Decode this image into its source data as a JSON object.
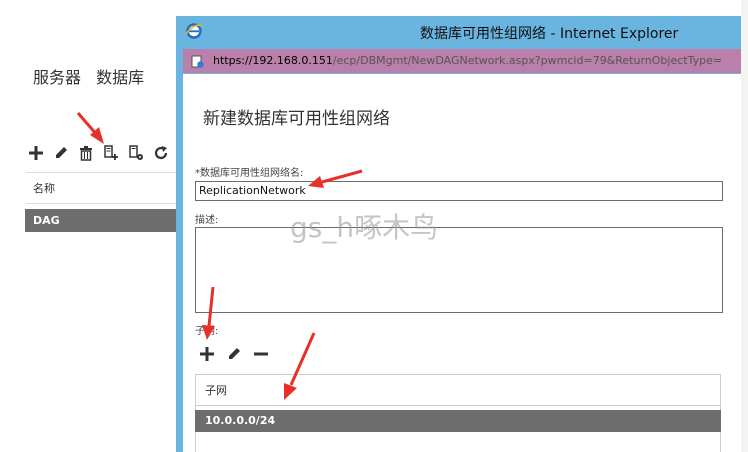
{
  "background": {
    "tabs": [
      "服务器",
      "数据库"
    ],
    "column_header": "名称",
    "row_value": "DAG",
    "toolbar_icons": [
      "plus-icon",
      "pencil-icon",
      "trash-icon",
      "new-network-icon",
      "network-settings-icon",
      "refresh-icon"
    ]
  },
  "dialog": {
    "title": "数据库可用性组网络 - Internet Explorer",
    "url_host": "https://192.168.0.151",
    "url_path": "/ecp/DBMgmt/NewDAGNetwork.aspx?pwmcid=79&ReturnObjectType=",
    "page_title": "新建数据库可用性组网络",
    "name_label": "*数据库可用性组网络名:",
    "name_value": "ReplicationNetwork",
    "desc_label": "描述:",
    "subnets_label": "子网:",
    "subnet_column": "子网",
    "subnet_row": "10.0.0.0/24"
  },
  "watermark": "gs_h啄木鸟",
  "colors": {
    "titlebar": "#6ab5e0",
    "addressbar": "#ba7fab",
    "selected_row": "#6d6d6d",
    "arrow": "#e8302a"
  }
}
